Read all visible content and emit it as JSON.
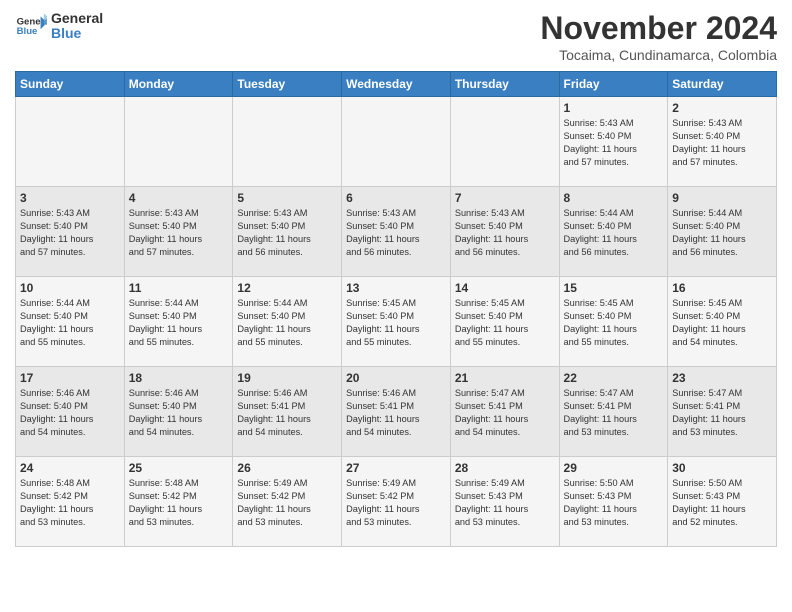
{
  "header": {
    "logo_line1": "General",
    "logo_line2": "Blue",
    "month_title": "November 2024",
    "location": "Tocaima, Cundinamarca, Colombia"
  },
  "days_of_week": [
    "Sunday",
    "Monday",
    "Tuesday",
    "Wednesday",
    "Thursday",
    "Friday",
    "Saturday"
  ],
  "weeks": [
    [
      {
        "day": "",
        "info": ""
      },
      {
        "day": "",
        "info": ""
      },
      {
        "day": "",
        "info": ""
      },
      {
        "day": "",
        "info": ""
      },
      {
        "day": "",
        "info": ""
      },
      {
        "day": "1",
        "info": "Sunrise: 5:43 AM\nSunset: 5:40 PM\nDaylight: 11 hours\nand 57 minutes."
      },
      {
        "day": "2",
        "info": "Sunrise: 5:43 AM\nSunset: 5:40 PM\nDaylight: 11 hours\nand 57 minutes."
      }
    ],
    [
      {
        "day": "3",
        "info": "Sunrise: 5:43 AM\nSunset: 5:40 PM\nDaylight: 11 hours\nand 57 minutes."
      },
      {
        "day": "4",
        "info": "Sunrise: 5:43 AM\nSunset: 5:40 PM\nDaylight: 11 hours\nand 57 minutes."
      },
      {
        "day": "5",
        "info": "Sunrise: 5:43 AM\nSunset: 5:40 PM\nDaylight: 11 hours\nand 56 minutes."
      },
      {
        "day": "6",
        "info": "Sunrise: 5:43 AM\nSunset: 5:40 PM\nDaylight: 11 hours\nand 56 minutes."
      },
      {
        "day": "7",
        "info": "Sunrise: 5:43 AM\nSunset: 5:40 PM\nDaylight: 11 hours\nand 56 minutes."
      },
      {
        "day": "8",
        "info": "Sunrise: 5:44 AM\nSunset: 5:40 PM\nDaylight: 11 hours\nand 56 minutes."
      },
      {
        "day": "9",
        "info": "Sunrise: 5:44 AM\nSunset: 5:40 PM\nDaylight: 11 hours\nand 56 minutes."
      }
    ],
    [
      {
        "day": "10",
        "info": "Sunrise: 5:44 AM\nSunset: 5:40 PM\nDaylight: 11 hours\nand 55 minutes."
      },
      {
        "day": "11",
        "info": "Sunrise: 5:44 AM\nSunset: 5:40 PM\nDaylight: 11 hours\nand 55 minutes."
      },
      {
        "day": "12",
        "info": "Sunrise: 5:44 AM\nSunset: 5:40 PM\nDaylight: 11 hours\nand 55 minutes."
      },
      {
        "day": "13",
        "info": "Sunrise: 5:45 AM\nSunset: 5:40 PM\nDaylight: 11 hours\nand 55 minutes."
      },
      {
        "day": "14",
        "info": "Sunrise: 5:45 AM\nSunset: 5:40 PM\nDaylight: 11 hours\nand 55 minutes."
      },
      {
        "day": "15",
        "info": "Sunrise: 5:45 AM\nSunset: 5:40 PM\nDaylight: 11 hours\nand 55 minutes."
      },
      {
        "day": "16",
        "info": "Sunrise: 5:45 AM\nSunset: 5:40 PM\nDaylight: 11 hours\nand 54 minutes."
      }
    ],
    [
      {
        "day": "17",
        "info": "Sunrise: 5:46 AM\nSunset: 5:40 PM\nDaylight: 11 hours\nand 54 minutes."
      },
      {
        "day": "18",
        "info": "Sunrise: 5:46 AM\nSunset: 5:40 PM\nDaylight: 11 hours\nand 54 minutes."
      },
      {
        "day": "19",
        "info": "Sunrise: 5:46 AM\nSunset: 5:41 PM\nDaylight: 11 hours\nand 54 minutes."
      },
      {
        "day": "20",
        "info": "Sunrise: 5:46 AM\nSunset: 5:41 PM\nDaylight: 11 hours\nand 54 minutes."
      },
      {
        "day": "21",
        "info": "Sunrise: 5:47 AM\nSunset: 5:41 PM\nDaylight: 11 hours\nand 54 minutes."
      },
      {
        "day": "22",
        "info": "Sunrise: 5:47 AM\nSunset: 5:41 PM\nDaylight: 11 hours\nand 53 minutes."
      },
      {
        "day": "23",
        "info": "Sunrise: 5:47 AM\nSunset: 5:41 PM\nDaylight: 11 hours\nand 53 minutes."
      }
    ],
    [
      {
        "day": "24",
        "info": "Sunrise: 5:48 AM\nSunset: 5:42 PM\nDaylight: 11 hours\nand 53 minutes."
      },
      {
        "day": "25",
        "info": "Sunrise: 5:48 AM\nSunset: 5:42 PM\nDaylight: 11 hours\nand 53 minutes."
      },
      {
        "day": "26",
        "info": "Sunrise: 5:49 AM\nSunset: 5:42 PM\nDaylight: 11 hours\nand 53 minutes."
      },
      {
        "day": "27",
        "info": "Sunrise: 5:49 AM\nSunset: 5:42 PM\nDaylight: 11 hours\nand 53 minutes."
      },
      {
        "day": "28",
        "info": "Sunrise: 5:49 AM\nSunset: 5:43 PM\nDaylight: 11 hours\nand 53 minutes."
      },
      {
        "day": "29",
        "info": "Sunrise: 5:50 AM\nSunset: 5:43 PM\nDaylight: 11 hours\nand 53 minutes."
      },
      {
        "day": "30",
        "info": "Sunrise: 5:50 AM\nSunset: 5:43 PM\nDaylight: 11 hours\nand 52 minutes."
      }
    ]
  ]
}
